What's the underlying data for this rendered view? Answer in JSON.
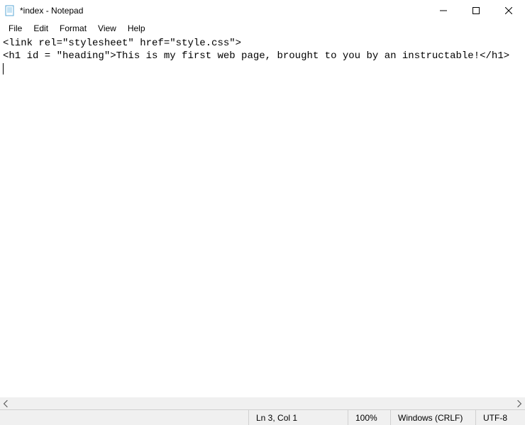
{
  "titlebar": {
    "title": "*index - Notepad"
  },
  "menubar": {
    "file": "File",
    "edit": "Edit",
    "format": "Format",
    "view": "View",
    "help": "Help"
  },
  "editor": {
    "line1": "<link rel=\"stylesheet\" href=\"style.css\">",
    "line2": "<h1 id = \"heading\">This is my first web page, brought to you by an instructable!</h1>"
  },
  "statusbar": {
    "position": "Ln 3, Col 1",
    "zoom": "100%",
    "eol": "Windows (CRLF)",
    "encoding": "UTF-8"
  }
}
